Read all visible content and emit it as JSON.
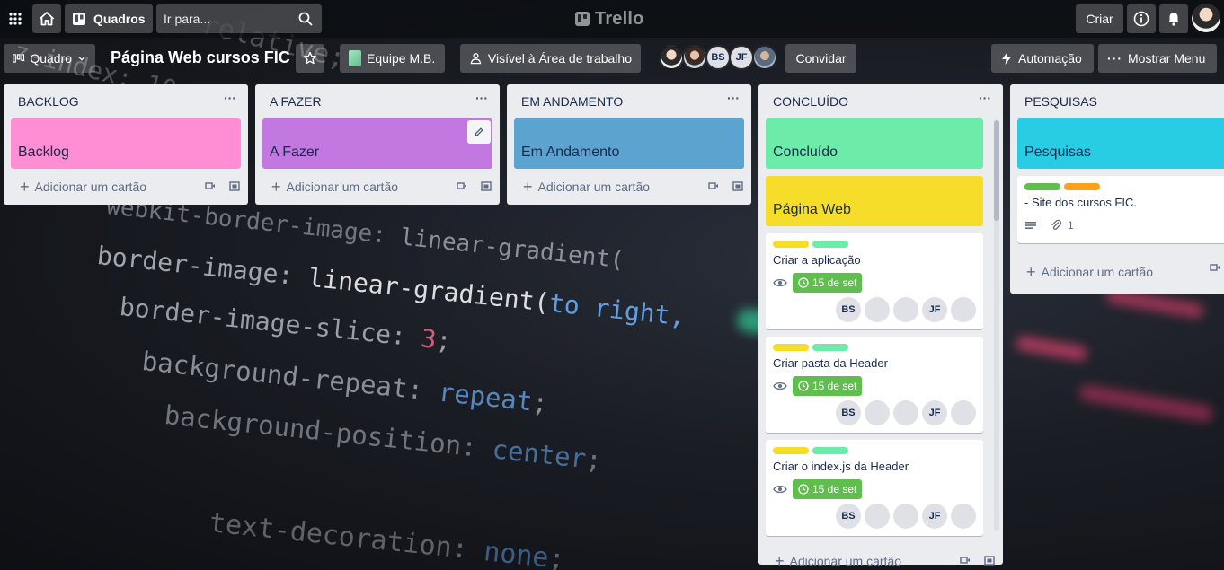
{
  "header": {
    "boards_label": "Quadros",
    "search_placeholder": "Ir para...",
    "brand": "Trello",
    "create_label": "Criar"
  },
  "board": {
    "view_label": "Quadro",
    "title": "Página Web cursos FIC",
    "team_label": "Equipe M.B.",
    "visibility_label": "Visível à Área de trabalho",
    "members": [
      {
        "type": "photo"
      },
      {
        "type": "photo"
      },
      {
        "initials": "BS"
      },
      {
        "initials": "JF"
      },
      {
        "type": "photo"
      }
    ],
    "invite_label": "Convidar",
    "automation_label": "Automação",
    "menu_label": "Mostrar Menu"
  },
  "add_card_label": "Adicionar um cartão",
  "lists": [
    {
      "name": "BACKLOG",
      "cover": {
        "title": "Backlog",
        "color": "#ff8ed4"
      }
    },
    {
      "name": "A FAZER",
      "cover": {
        "title": "A Fazer",
        "color": "#c377e0"
      }
    },
    {
      "name": "EM ANDAMENTO",
      "cover": {
        "title": "Em Andamento",
        "color": "#5ba4cf"
      }
    },
    {
      "name": "CONCLUÍDO",
      "covers": [
        {
          "title": "Concluído",
          "color": "#6deca9"
        },
        {
          "title": "Página Web",
          "color": "#f5dd29"
        }
      ],
      "cards": [
        {
          "title": "Criar a aplicação",
          "labels": [
            "#f5dd29",
            "#6deca9"
          ],
          "due": "15 de set",
          "members": [
            "BS",
            "photo",
            "photo",
            "JF",
            "photo"
          ]
        },
        {
          "title": "Criar pasta da Header",
          "labels": [
            "#f5dd29",
            "#6deca9"
          ],
          "due": "15 de set",
          "members": [
            "BS",
            "photo",
            "photo",
            "JF",
            "photo"
          ]
        },
        {
          "title": "Criar o index.js da Header",
          "labels": [
            "#f5dd29",
            "#6deca9"
          ],
          "due": "15 de set",
          "members": [
            "BS",
            "photo",
            "photo",
            "JF",
            "photo"
          ]
        }
      ]
    },
    {
      "name": "PESQUISAS",
      "cover": {
        "title": "Pesquisas",
        "color": "#29cce5"
      },
      "cards": [
        {
          "title": "- Site dos cursos FIC.",
          "labels": [
            "#61bd4f",
            "#ff9f1a"
          ],
          "attachments": "1"
        }
      ]
    }
  ],
  "colors": {
    "due_green": "#61bd4f",
    "list_bg": "#ebecf0"
  }
}
